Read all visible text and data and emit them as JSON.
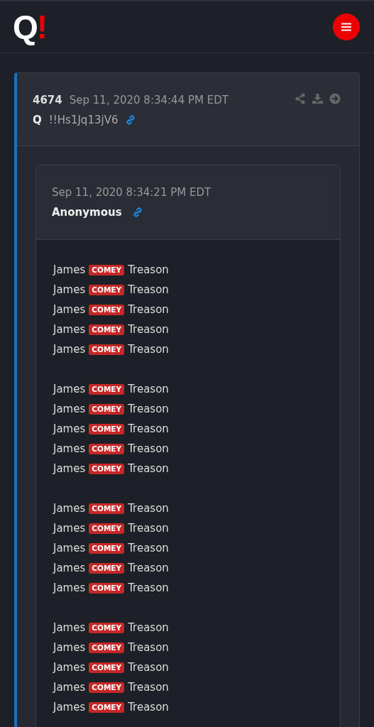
{
  "header": {
    "logo": {
      "letter": "Q",
      "mark": "!"
    }
  },
  "post": {
    "number": "4674",
    "timestamp": "Sep 11, 2020 8:34:44 PM EDT",
    "author": "Q",
    "tripcode": "!!Hs1Jq13jV6",
    "reference": {
      "timestamp": "Sep 11, 2020 8:34:21 PM EDT",
      "author": "Anonymous",
      "paragraphs": [
        {
          "lines": [
            {
              "before": "James",
              "tag": "COMEY",
              "after": "Treason"
            },
            {
              "before": "James",
              "tag": "COMEY",
              "after": "Treason"
            },
            {
              "before": "James",
              "tag": "COMEY",
              "after": "Treason"
            },
            {
              "before": "James",
              "tag": "COMEY",
              "after": "Treason"
            },
            {
              "before": "James",
              "tag": "COMEY",
              "after": "Treason"
            }
          ]
        },
        {
          "lines": [
            {
              "before": "James",
              "tag": "COMEY",
              "after": "Treason"
            },
            {
              "before": "James",
              "tag": "COMEY",
              "after": "Treason"
            },
            {
              "before": "James",
              "tag": "COMEY",
              "after": "Treason"
            },
            {
              "before": "James",
              "tag": "COMEY",
              "after": "Treason"
            },
            {
              "before": "James",
              "tag": "COMEY",
              "after": "Treason"
            }
          ]
        },
        {
          "lines": [
            {
              "before": "James",
              "tag": "COMEY",
              "after": "Treason"
            },
            {
              "before": "James",
              "tag": "COMEY",
              "after": "Treason"
            },
            {
              "before": "James",
              "tag": "COMEY",
              "after": "Treason"
            },
            {
              "before": "James",
              "tag": "COMEY",
              "after": "Treason"
            },
            {
              "before": "James",
              "tag": "COMEY",
              "after": "Treason"
            }
          ]
        },
        {
          "lines": [
            {
              "before": "James",
              "tag": "COMEY",
              "after": "Treason"
            },
            {
              "before": "James",
              "tag": "COMEY",
              "after": "Treason"
            },
            {
              "before": "James",
              "tag": "COMEY",
              "after": "Treason"
            },
            {
              "before": "James",
              "tag": "COMEY",
              "after": "Treason"
            },
            {
              "before": "James",
              "tag": "COMEY",
              "after": "Treason"
            }
          ]
        }
      ]
    }
  }
}
